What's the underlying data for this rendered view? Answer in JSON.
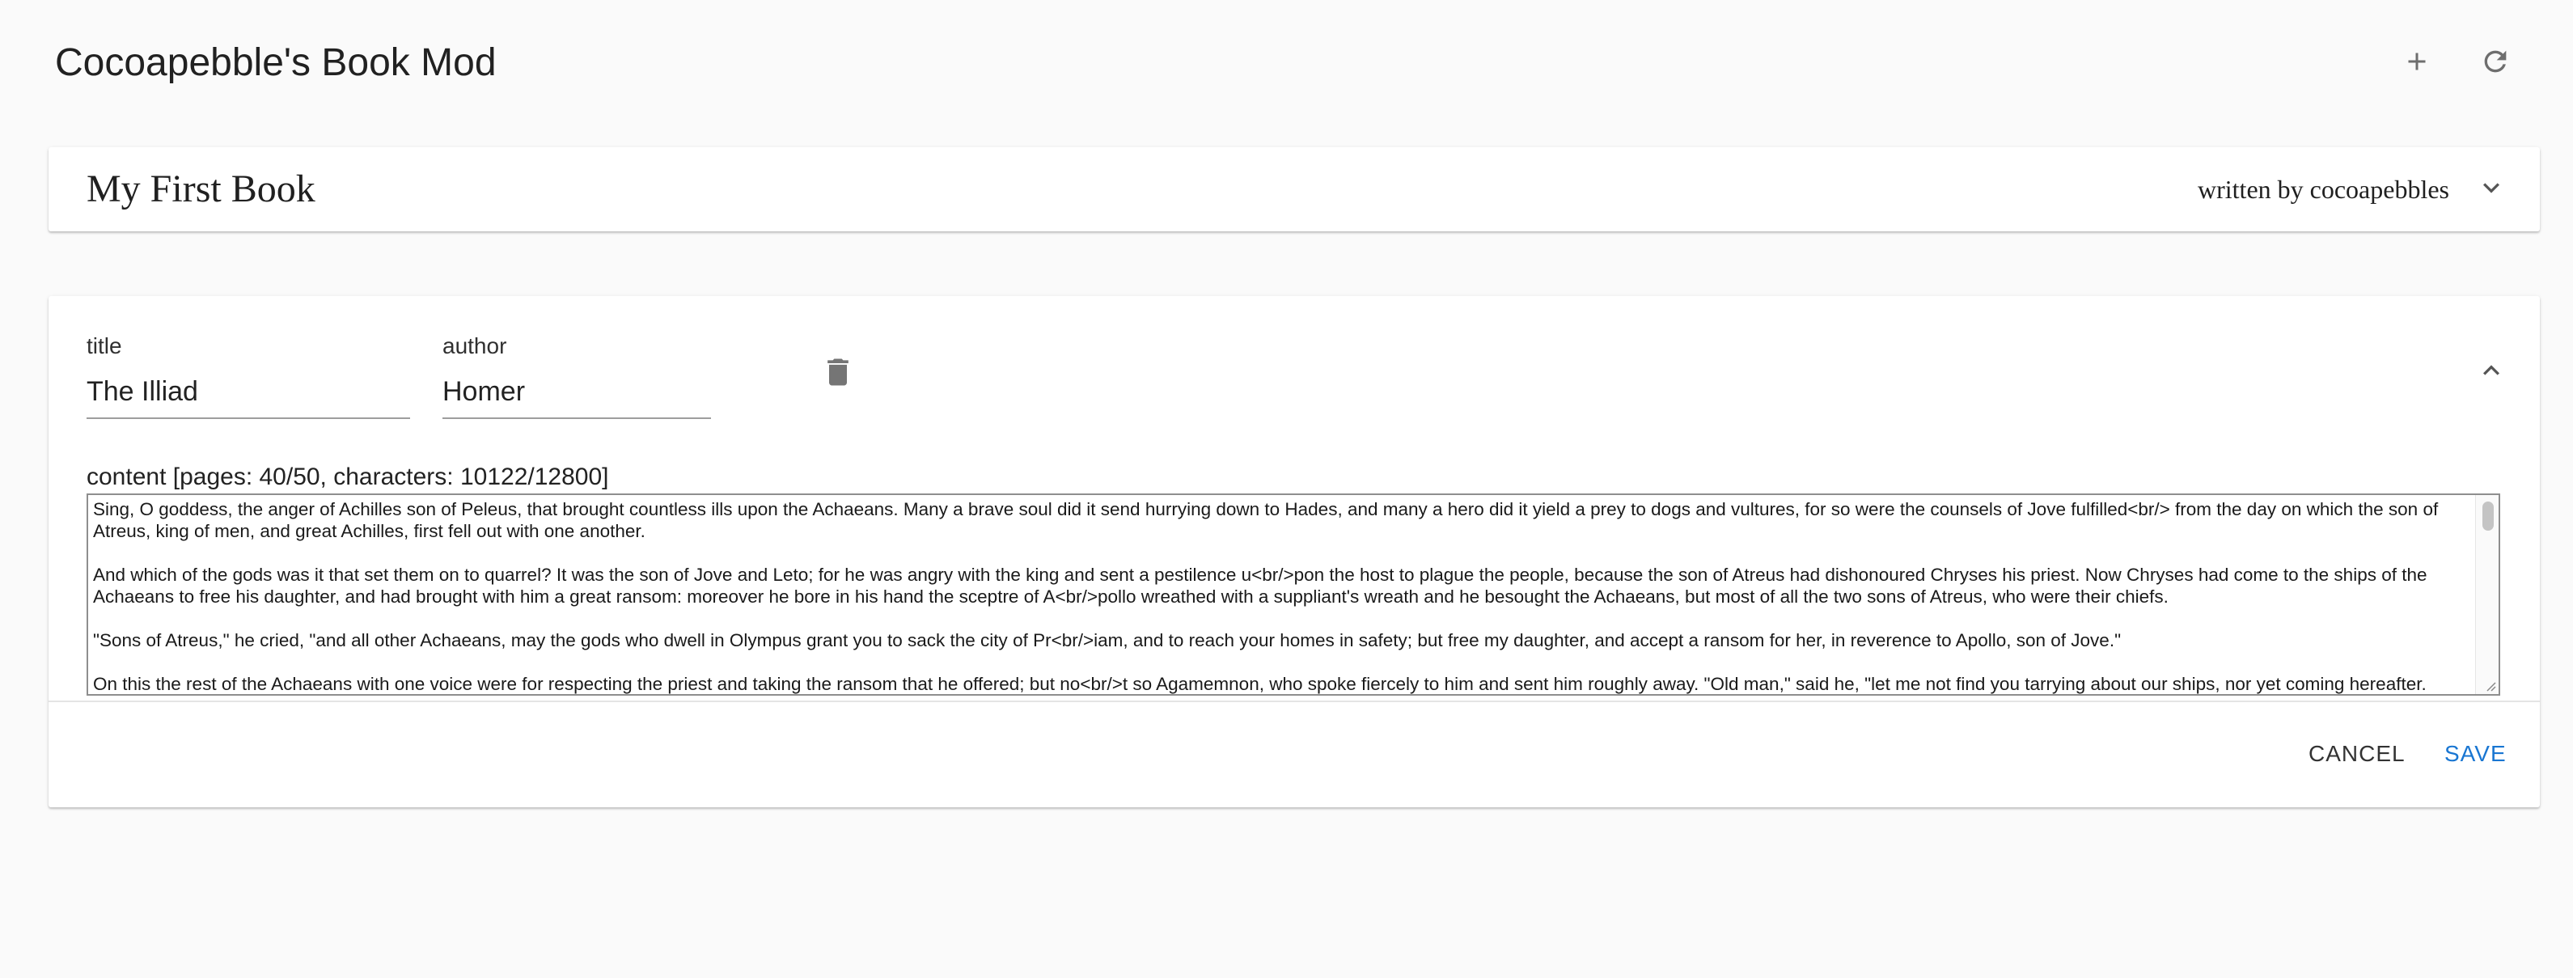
{
  "app": {
    "title": "Cocoapebble's Book Mod",
    "icons": {
      "add": "plus-icon",
      "refresh": "refresh-icon"
    }
  },
  "book": {
    "title": "My First Book",
    "byline": "written by cocoapebbles",
    "expand_icon": "chevron-down-icon"
  },
  "editor": {
    "title_label": "title",
    "title_value": "The Illiad",
    "author_label": "author",
    "author_value": "Homer",
    "delete_icon": "trash-icon",
    "collapse_icon": "chevron-up-icon",
    "content_label": "content [pages: 40/50, characters: 10122/12800]",
    "content_text": "Sing, O goddess, the anger of Achilles son of Peleus, that brought countless ills upon the Achaeans. Many a brave soul did it send hurrying down to Hades, and many a hero did it yield a prey to dogs and vultures, for so were the counsels of Jove fulfilled<br/> from the day on which the son of Atreus, king of men, and great Achilles, first fell out with one another.\n\nAnd which of the gods was it that set them on to quarrel? It was the son of Jove and Leto; for he was angry with the king and sent a pestilence u<br/>pon the host to plague the people, because the son of Atreus had dishonoured Chryses his priest. Now Chryses had come to the ships of the Achaeans to free his daughter, and had brought with him a great ransom: moreover he bore in his hand the sceptre of A<br/>pollo wreathed with a suppliant's wreath and he besought the Achaeans, but most of all the two sons of Atreus, who were their chiefs.\n\n\"Sons of Atreus,\" he cried, \"and all other Achaeans, may the gods who dwell in Olympus grant you to sack the city of Pr<br/>iam, and to reach your homes in safety; but free my daughter, and accept a ransom for her, in reverence to Apollo, son of Jove.\"\n\nOn this the rest of the Achaeans with one voice were for respecting the priest and taking the ransom that he offered; but no<br/>t so Agamemnon, who spoke fiercely to him and sent him roughly away. \"Old man,\" said he, \"let me not find you tarrying about our ships, nor yet coming hereafter.",
    "cancel_label": "CANCEL",
    "save_label": "SAVE",
    "save_color": "#1976d2"
  }
}
